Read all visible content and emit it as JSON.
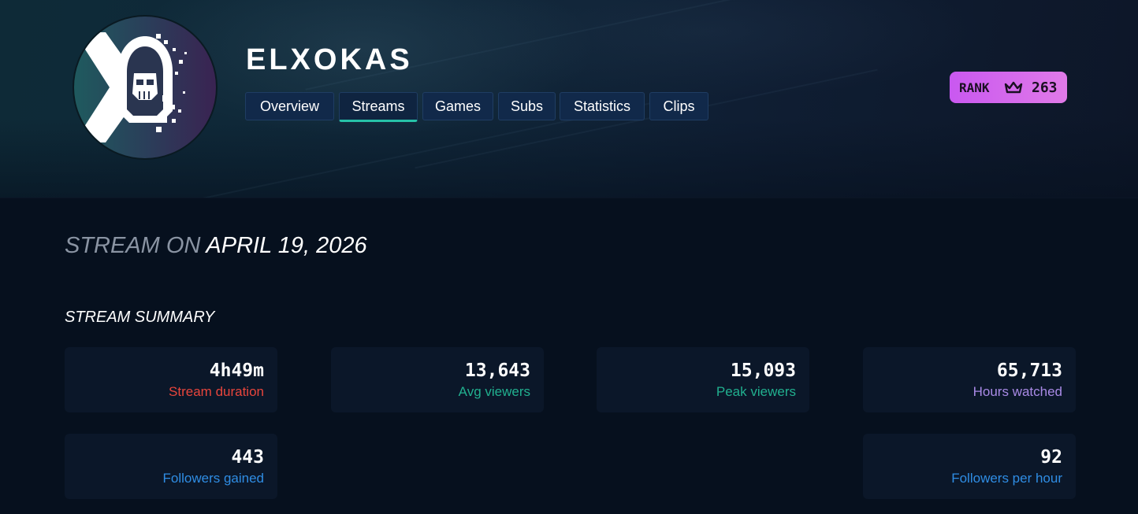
{
  "profile": {
    "username": "ELXOKAS",
    "avatar_icon": "hooded-skull-logo-icon"
  },
  "tabs": [
    {
      "label": "Overview",
      "active": false
    },
    {
      "label": "Streams",
      "active": true
    },
    {
      "label": "Games",
      "active": false
    },
    {
      "label": "Subs",
      "active": false
    },
    {
      "label": "Statistics",
      "active": false
    },
    {
      "label": "Clips",
      "active": false
    }
  ],
  "rank": {
    "label": "RANK",
    "icon": "crown-icon",
    "value": "263"
  },
  "stream": {
    "title_prefix": "STREAM ON",
    "date": "APRIL 19, 2026"
  },
  "summary": {
    "heading": "STREAM SUMMARY",
    "stats": [
      {
        "value": "4h49m",
        "label": "Stream duration",
        "color": "#e8453c"
      },
      {
        "value": "13,643",
        "label": "Avg viewers",
        "color": "#21b08f"
      },
      {
        "value": "15,093",
        "label": "Peak viewers",
        "color": "#21b08f"
      },
      {
        "value": "65,713",
        "label": "Hours watched",
        "color": "#a98ae6"
      },
      {
        "value": "443",
        "label": "Followers gained",
        "color": "#2f8de4"
      },
      {
        "value": "92",
        "label": "Followers per hour",
        "color": "#2f8de4"
      }
    ]
  },
  "colors": {
    "background": "#06101e",
    "accent_teal": "#27c2a8",
    "rank_badge": "#d96ae8"
  }
}
